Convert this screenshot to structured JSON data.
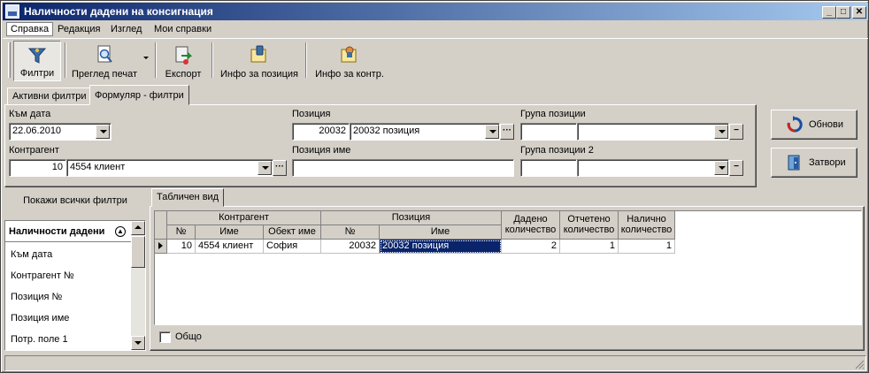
{
  "window": {
    "title": "Наличности дадени на консигнация",
    "min_glyph": "_",
    "max_glyph": "□",
    "close_glyph": "✕"
  },
  "menu": [
    "Справка",
    "Редакция",
    "Изглед",
    "Мои справки"
  ],
  "toolbar": {
    "filters": "Филтри",
    "print_preview": "Преглед печат",
    "export": "Експорт",
    "info_position": "Инфо за позиция",
    "info_contr": "Инфо за контр."
  },
  "filter_tabs": [
    "Активни филтри",
    "Формуляр - филтри"
  ],
  "form": {
    "date_label": "Към дата",
    "date_value": "22.06.2010",
    "contr_label": "Контрагент",
    "contr_no": "10",
    "contr_name": "4554 клиент",
    "pos_label": "Позиция",
    "pos_no": "20032",
    "pos_name": "20032 позиция",
    "pos_name_label": "Позиция име",
    "pos_name_value": "",
    "group_label": "Група позиции",
    "group2_label": "Група позиции 2",
    "ellipsis": "···",
    "minus": "−"
  },
  "buttons": {
    "refresh": "Обнови",
    "close": "Затвори"
  },
  "left": {
    "show_all": "Покажи всички филтри",
    "items": [
      "Наличности дадени",
      "Към дата",
      "Контрагент №",
      "Позиция №",
      "Позиция име",
      "Потр. поле 1"
    ]
  },
  "grid_tab": "Табличен вид",
  "grid": {
    "group_headers": [
      "Контрагент",
      "Позиция"
    ],
    "columns": [
      "№",
      "Име",
      "Обект име",
      "№",
      "Име",
      "Дадено количество",
      "Отчетено количество",
      "Налично количество"
    ],
    "col_lines": [
      [
        "Дадено",
        "количество"
      ],
      [
        "Отчетено",
        "количество"
      ],
      [
        "Налично",
        "количество"
      ]
    ],
    "rows": [
      [
        "10",
        "4554 клиент",
        "София",
        "20032",
        "20032 позиция",
        "2",
        "1",
        "1"
      ]
    ]
  },
  "total_label": "Общо"
}
